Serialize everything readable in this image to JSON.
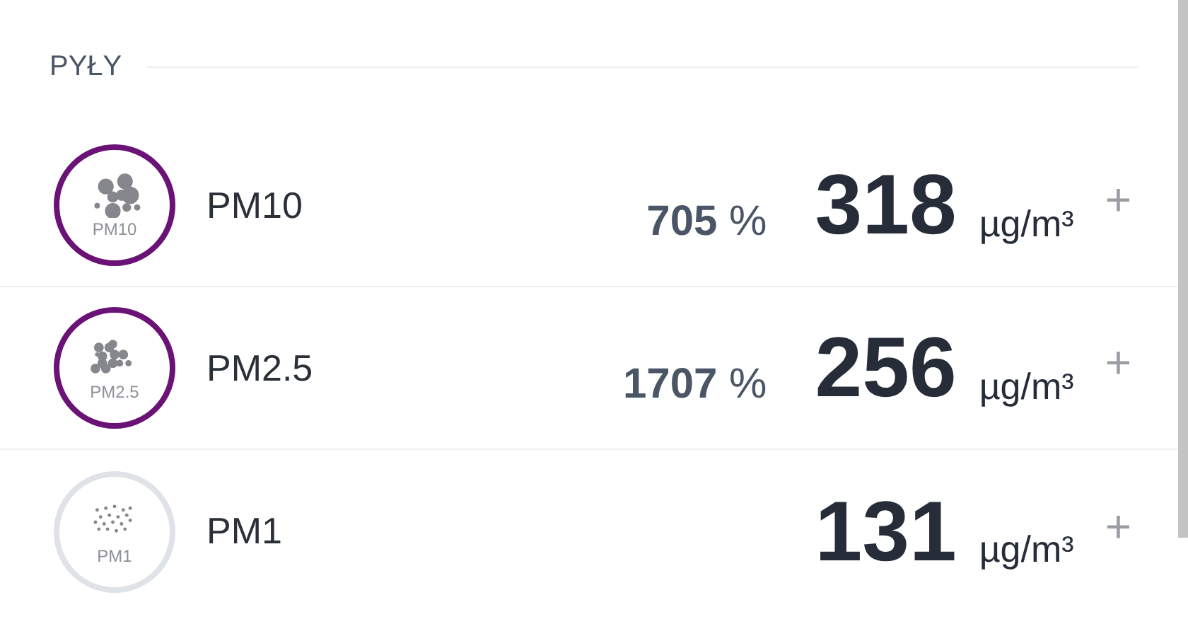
{
  "section": {
    "title": "PYŁY"
  },
  "rows": [
    {
      "kind": "coarse",
      "badge_label": "PM10",
      "name": "PM10",
      "color": "#6b1276",
      "percent": "**705** %",
      "value": "318",
      "unit": "µg/m³",
      "action": "+"
    },
    {
      "kind": "fine",
      "badge_label": "PM2.5",
      "name": "PM2.5",
      "color": "#6b1276",
      "percent": "**1707** %",
      "value": "256",
      "unit": "µg/m³",
      "action": "+"
    },
    {
      "kind": "ultrafine",
      "badge_label": "PM1",
      "name": "PM1",
      "color": "#dfe2e7",
      "value": "131",
      "unit": "µg/m³",
      "action": "+"
    }
  ]
}
